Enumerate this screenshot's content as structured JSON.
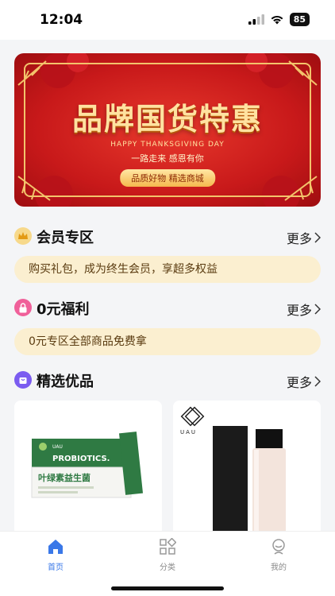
{
  "status_bar": {
    "time": "12:04",
    "battery": "85"
  },
  "banner": {
    "title": "品牌国货特惠",
    "english_line": "HAPPY THANKSGIVING DAY",
    "subtitle": "一路走来 感恩有你",
    "pill": "品质好物  精选商城"
  },
  "sections": {
    "vip": {
      "title": "会员专区",
      "more": "更多",
      "bar_text": "购买礼包，成为终生会员，享超多权益"
    },
    "free": {
      "title": "0元福利",
      "more": "更多",
      "bar_text": "0元专区全部商品免费拿"
    },
    "picks": {
      "title": "精选优品",
      "more": "更多"
    }
  },
  "products": [
    {
      "brand": "UAU",
      "badge": "PROBIOTICS.",
      "name": "叶绿素益生菌"
    },
    {
      "brand": "UAU"
    }
  ],
  "tabs": [
    {
      "label": "首页"
    },
    {
      "label": "分类"
    },
    {
      "label": "我的"
    }
  ],
  "colors": {
    "accent": "#3a78e8",
    "vip_icon": "#f1b52a",
    "free_icon": "#f0609a",
    "picks_icon": "#7b5cf0",
    "info_bg": "#fbefd0",
    "banner_red": "#c8191a"
  }
}
